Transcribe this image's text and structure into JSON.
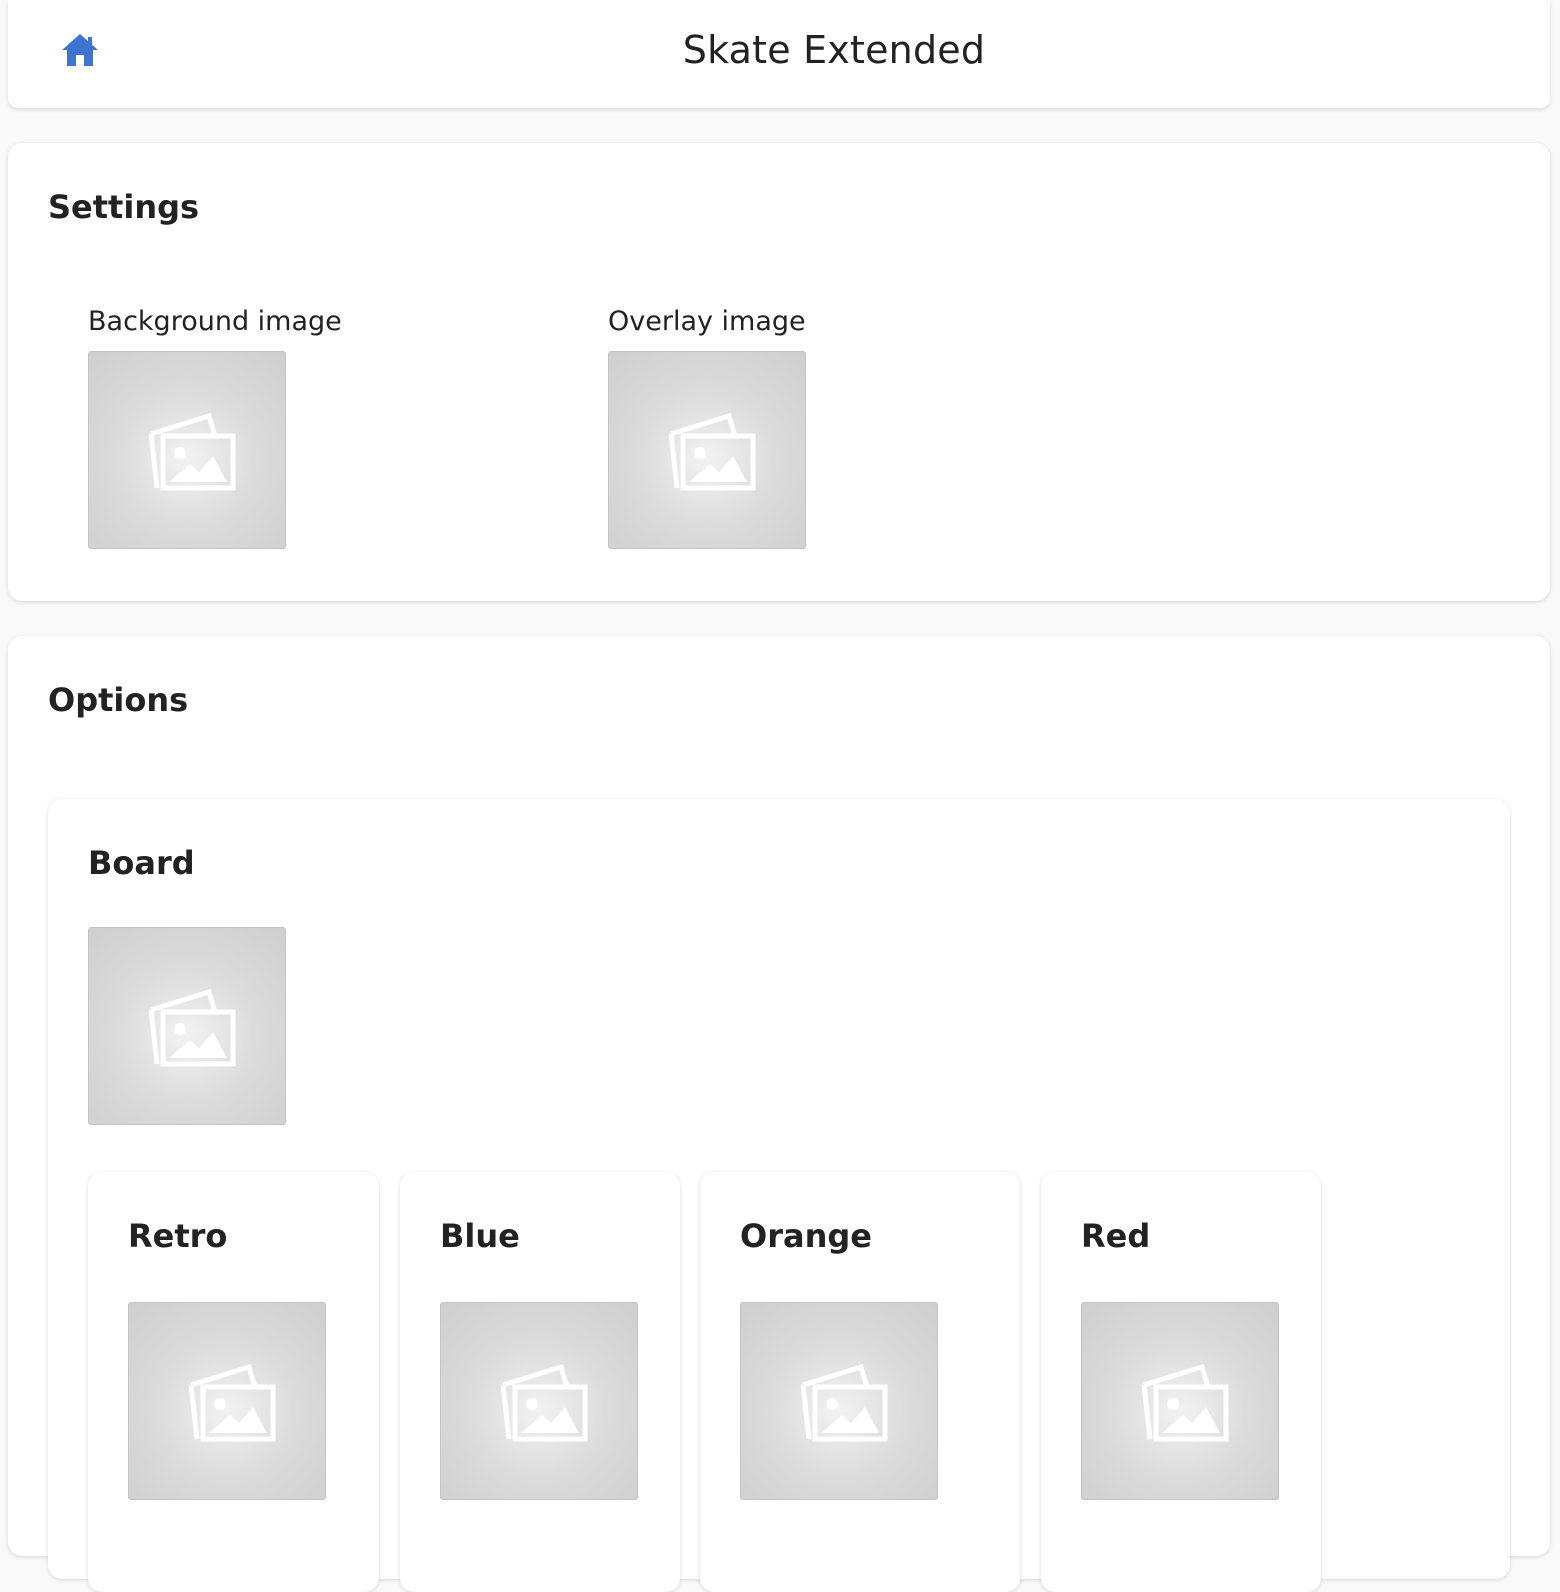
{
  "header": {
    "title": "Skate Extended",
    "home_icon": "home-icon",
    "accent_color": "#3f74d1"
  },
  "settings": {
    "title": "Settings",
    "fields": [
      {
        "label": "Background image",
        "icon": "image-placeholder-icon"
      },
      {
        "label": "Overlay image",
        "icon": "image-placeholder-icon"
      }
    ]
  },
  "options": {
    "title": "Options",
    "board": {
      "title": "Board",
      "icon": "image-placeholder-icon",
      "variants": [
        {
          "title": "Retro"
        },
        {
          "title": "Blue"
        },
        {
          "title": "Orange"
        },
        {
          "title": "Red"
        }
      ]
    }
  }
}
